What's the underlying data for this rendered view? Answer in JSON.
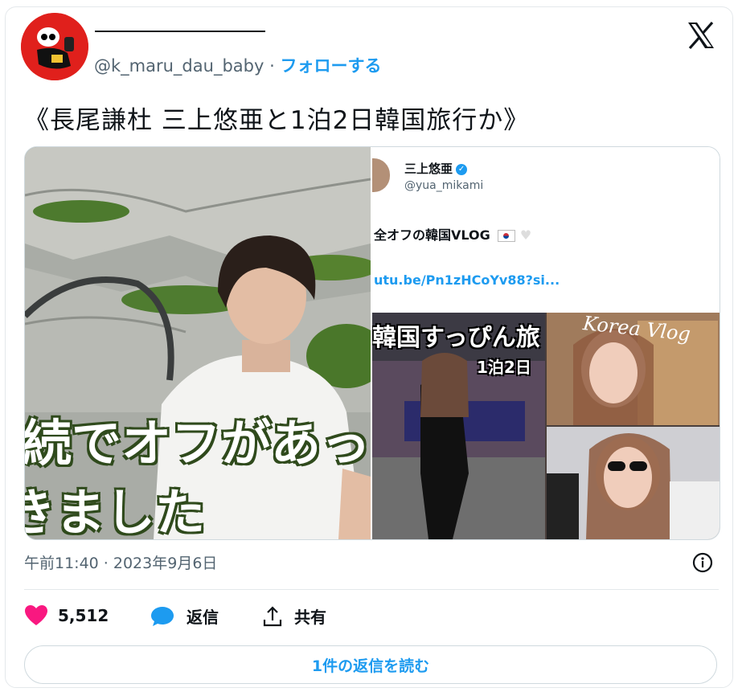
{
  "author": {
    "handle": "@k_maru_dau_baby",
    "separator": "·",
    "follow_label": "フォローする"
  },
  "tweet": {
    "text": "《長尾謙杜 三上悠亜と1泊2日韓国旅行か》",
    "timestamp": "午前11:40 · 2023年9月6日"
  },
  "media": {
    "left_overlay_line1": "続でオフがあっ",
    "left_overlay_line2": "きました",
    "quoted": {
      "name": "三上悠亜",
      "handle": "@yua_mikami",
      "text": "全オフの韓国VLOG",
      "link": "utu.be/Pn1zHCoYv88?si...",
      "thumb_title": "韓国すっぴん旅",
      "thumb_day": "1泊2日",
      "thumb_script": "Korea Vlog"
    }
  },
  "actions": {
    "likes": "5,512",
    "reply_label": "返信",
    "share_label": "共有"
  },
  "read_replies_label": "1件の返信を読む",
  "colors": {
    "accent": "#1d9bf0",
    "like": "#f91880",
    "muted": "#536471",
    "border": "#cfd9de"
  },
  "icons": [
    "x-logo-icon",
    "info-icon",
    "heart-icon",
    "reply-bubble-icon",
    "share-icon",
    "verified-icon"
  ]
}
